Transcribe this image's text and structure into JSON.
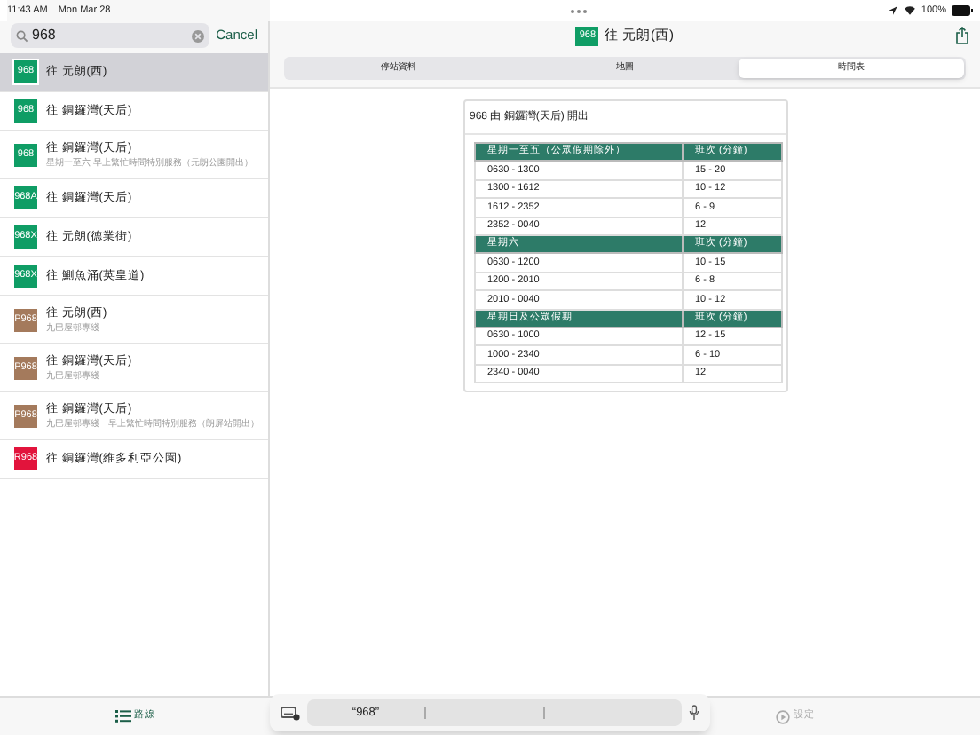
{
  "status_bar": {
    "time": "11:43 AM",
    "date": "Mon Mar 28",
    "battery": "100%"
  },
  "search": {
    "value": "968",
    "cancel": "Cancel"
  },
  "routes": [
    {
      "route": "968",
      "color": "#0f9d65",
      "title": "往 元朗(西)",
      "selected": true
    },
    {
      "route": "968",
      "color": "#0f9d65",
      "title": "往 銅鑼灣(天后)",
      "selected": false
    },
    {
      "route": "968",
      "color": "#0f9d65",
      "title": "往 銅鑼灣(天后)",
      "subtitle": "星期一至六 早上繁忙時間特別服務（元朗公園開出）",
      "selected": false
    },
    {
      "route": "968A",
      "color": "#0f9d65",
      "title": "往 銅鑼灣(天后)",
      "selected": false
    },
    {
      "route": "968X",
      "color": "#0f9d65",
      "title": "往 元朗(德業街)",
      "selected": false
    },
    {
      "route": "968X",
      "color": "#0f9d65",
      "title": "往 鰂魚涌(英皇道)",
      "selected": false
    },
    {
      "route": "P968",
      "color": "#a47a5c",
      "title": "往 元朗(西)",
      "subtitle": "九巴屋邨專綫",
      "selected": false
    },
    {
      "route": "P968",
      "color": "#a47a5c",
      "title": "往 銅鑼灣(天后)",
      "subtitle": "九巴屋邨專綫",
      "selected": false
    },
    {
      "route": "P968",
      "color": "#a47a5c",
      "title": "往 銅鑼灣(天后)",
      "subtitle": "九巴屋邨專綫　早上繁忙時間特別服務（朗屏站開出）",
      "selected": false
    },
    {
      "route": "R968",
      "color": "#e2143c",
      "title": "往 銅鑼灣(維多利亞公園)",
      "selected": false
    }
  ],
  "header": {
    "route": "968",
    "title": "往 元朗(西)"
  },
  "tabs": [
    {
      "label": "停站資料",
      "selected": false
    },
    {
      "label": "地圖",
      "selected": false
    },
    {
      "label": "時間表",
      "selected": true
    }
  ],
  "timetable": {
    "title": "968 由 銅鑼灣(天后) 開出",
    "sections": [
      {
        "heading": "星期一至五（公眾假期除外）",
        "column_2": "班次 (分鐘)",
        "rows": [
          [
            "0630 - 1300",
            "15 - 20"
          ],
          [
            "1300 - 1612",
            "10 - 12"
          ],
          [
            "1612 - 2352",
            "6 - 9"
          ],
          [
            "2352 - 0040",
            "12"
          ]
        ]
      },
      {
        "heading": "星期六",
        "column_2": "班次 (分鐘)",
        "rows": [
          [
            "0630 - 1200",
            "10 - 15"
          ],
          [
            "1200 - 2010",
            "6 - 8"
          ],
          [
            "2010 - 0040",
            "10 - 12"
          ]
        ]
      },
      {
        "heading": "星期日及公眾假期",
        "column_2": "班次 (分鐘)",
        "rows": [
          [
            "0630 - 1000",
            "12 - 15"
          ],
          [
            "1000 - 2340",
            "6 - 10"
          ],
          [
            "2340 - 0040",
            "12"
          ]
        ]
      }
    ]
  },
  "bottom_tabs": [
    {
      "label": "路線",
      "selected": true
    },
    {
      "label": "設定",
      "selected": false
    }
  ],
  "keyboard_suggestion": "“968”"
}
